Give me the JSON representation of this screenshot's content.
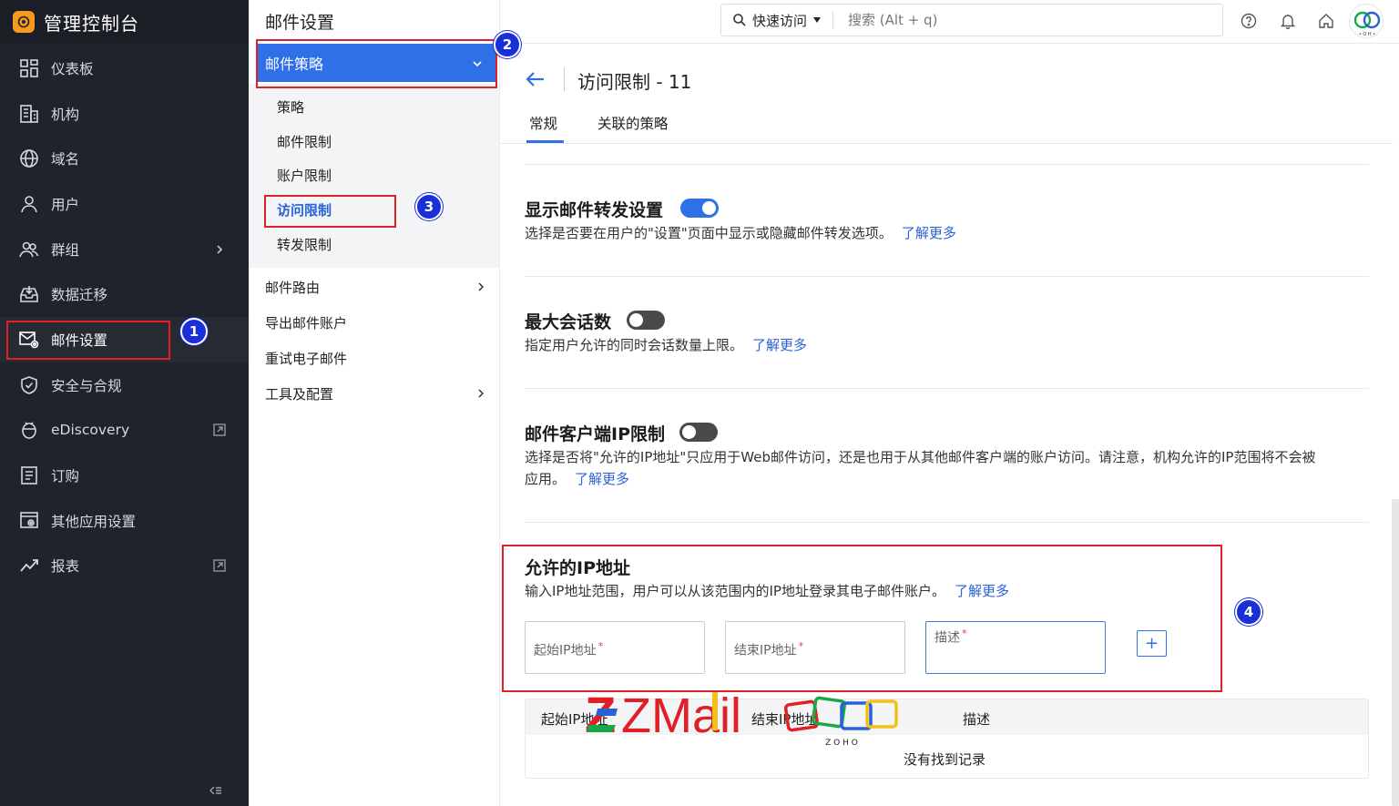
{
  "app": {
    "title": "管理控制台"
  },
  "sidebar": {
    "items": [
      {
        "label": "仪表板",
        "icon": "dashboard-icon"
      },
      {
        "label": "机构",
        "icon": "building-icon"
      },
      {
        "label": "域名",
        "icon": "globe-icon"
      },
      {
        "label": "用户",
        "icon": "user-icon"
      },
      {
        "label": "群组",
        "icon": "group-icon"
      },
      {
        "label": "数据迁移",
        "icon": "inbox-download-icon"
      },
      {
        "label": "邮件设置",
        "icon": "mail-settings-icon"
      },
      {
        "label": "安全与合规",
        "icon": "shield-icon"
      },
      {
        "label": "eDiscovery",
        "icon": "ediscovery-icon"
      },
      {
        "label": "订购",
        "icon": "subscription-icon"
      },
      {
        "label": "其他应用设置",
        "icon": "apps-settings-icon"
      },
      {
        "label": "报表",
        "icon": "trend-icon"
      }
    ]
  },
  "subnav": {
    "title": "邮件设置",
    "policy_header": "邮件策略",
    "policy_items": [
      "策略",
      "邮件限制",
      "账户限制",
      "访问限制",
      "转发限制"
    ],
    "other_items": [
      "邮件路由",
      "导出邮件账户",
      "重试电子邮件",
      "工具及配置"
    ]
  },
  "topbar": {
    "quick_access": "快速访问",
    "search_placeholder": "搜索 (Alt + q)"
  },
  "page": {
    "title": "访问限制 - 11",
    "tabs": [
      "常规",
      "关联的策略"
    ]
  },
  "sections": {
    "forward": {
      "title": "显示邮件转发设置",
      "desc": "选择是否要在用户的\"设置\"页面中显示或隐藏邮件转发选项。",
      "learn": "了解更多",
      "enabled": true
    },
    "sessions": {
      "title": "最大会话数",
      "desc": "指定用户允许的同时会话数量上限。",
      "learn": "了解更多",
      "enabled": false
    },
    "client_ip": {
      "title": "邮件客户端IP限制",
      "desc_line1": "选择是否将\"允许的IP地址\"只应用于Web邮件访问，还是也用于从其他邮件客户端的账户访问。请注意，机构允许的IP范围将不会被",
      "desc_line2": "应用。",
      "learn": "了解更多",
      "enabled": false
    },
    "allowed_ip": {
      "title": "允许的IP地址",
      "desc": "输入IP地址范围，用户可以从该范围内的IP地址登录其电子邮件账户。",
      "learn": "了解更多",
      "start_placeholder": "起始IP地址",
      "end_placeholder": "结束IP地址",
      "desc_placeholder": "描述",
      "add_label": "+"
    }
  },
  "table": {
    "headers": [
      "起始IP地址",
      "结束IP地址",
      "描述"
    ],
    "empty_text": "没有找到记录"
  },
  "annotations": [
    "1",
    "2",
    "3",
    "4"
  ],
  "watermark": {
    "zmail": "ZMail",
    "zoho": "Z O H O"
  },
  "colors": {
    "accent": "#2f6fe8",
    "sidebar_bg": "#1f232b",
    "annotation_red": "#e01f26",
    "badge_blue": "#1b2fd9"
  }
}
